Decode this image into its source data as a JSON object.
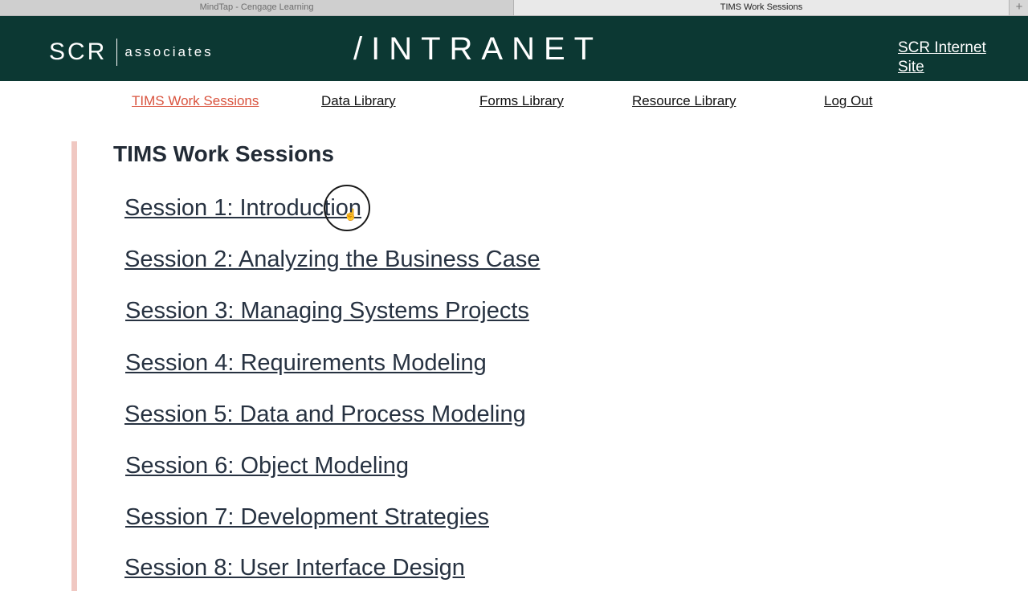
{
  "browser": {
    "tabs": [
      {
        "label": "MindTap - Cengage Learning",
        "active": false
      },
      {
        "label": "TIMS Work Sessions",
        "active": true
      }
    ],
    "new_tab_label": "+"
  },
  "header": {
    "logo_scr": "SCR",
    "logo_associates": "associates",
    "title": "/INTRANET",
    "internet_site_line1": "SCR Internet",
    "internet_site_line2": "Site",
    "background_color": "#0c3833"
  },
  "nav": {
    "items": [
      {
        "label": "TIMS Work Sessions",
        "current": true
      },
      {
        "label": "Data Library",
        "current": false
      },
      {
        "label": "Forms Library",
        "current": false
      },
      {
        "label": "Resource Library",
        "current": false
      },
      {
        "label": "Log Out",
        "current": false
      }
    ],
    "current_color": "#d9533e"
  },
  "main": {
    "title": "TIMS Work Sessions",
    "sessions": [
      "Session 1: Introduction",
      "Session 2: Analyzing the Business Case",
      "Session 3: Managing Systems Projects",
      "Session 4: Requirements Modeling",
      "Session 5: Data and Process Modeling",
      "Session 6: Object Modeling",
      "Session 7: Development Strategies",
      "Session 8: User Interface Design"
    ]
  }
}
